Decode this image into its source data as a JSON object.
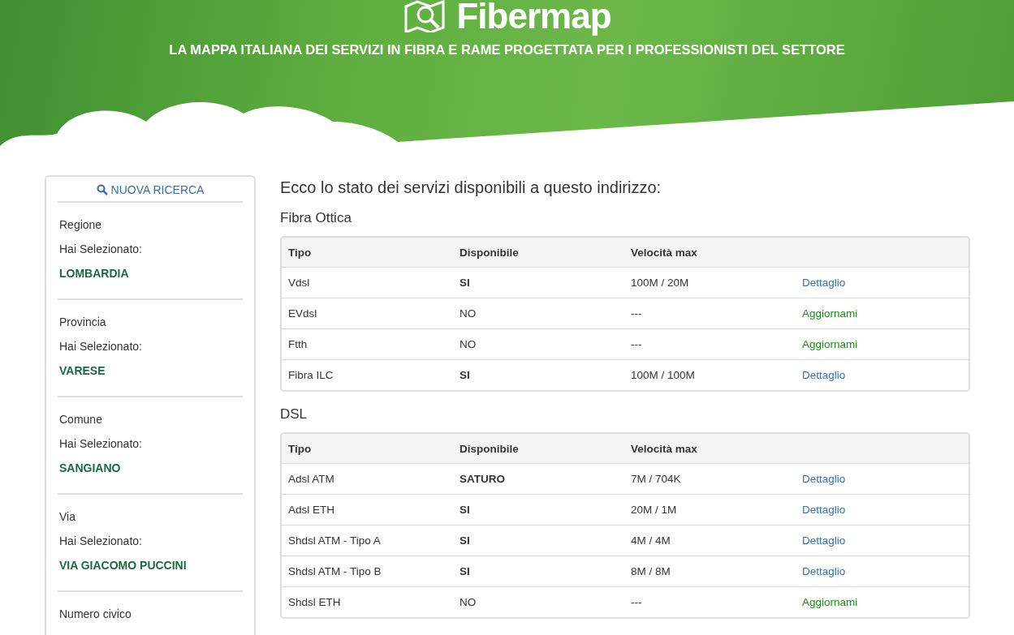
{
  "header": {
    "logo": "Fibermap",
    "tagline": "LA MAPPA ITALIANA DEI SERVIZI IN FIBRA E RAME PROGETTATA PER I PROFESSIONISTI DEL SETTORE"
  },
  "sidebar": {
    "search_link": "NUOVA RICERCA",
    "sections": [
      {
        "label": "Regione",
        "prompt": "Hai Selezionato:",
        "value": "LOMBARDIA"
      },
      {
        "label": "Provincia",
        "prompt": "Hai Selezionato:",
        "value": "VARESE"
      },
      {
        "label": "Comune",
        "prompt": "Hai Selezionato:",
        "value": "SANGIANO"
      },
      {
        "label": "Via",
        "prompt": "Hai Selezionato:",
        "value": "VIA GIACOMO PUCCINI"
      },
      {
        "label": "Numero civico"
      }
    ]
  },
  "main": {
    "heading": "Ecco lo stato dei servizi disponibili a questo indirizzo:",
    "groups": [
      {
        "title": "Fibra Ottica",
        "columns": [
          "Tipo",
          "Disponibile",
          "Velocità max"
        ],
        "rows": [
          {
            "type": "Vdsl",
            "available": "SI",
            "highlight": true,
            "speed": "100M / 20M",
            "action": {
              "kind": "details",
              "label": "Dettaglio"
            }
          },
          {
            "type": "EVdsl",
            "available": "NO",
            "highlight": false,
            "speed": "---",
            "action": {
              "kind": "upgrade",
              "label": "Aggiornami"
            }
          },
          {
            "type": "Ftth",
            "available": "NO",
            "highlight": false,
            "speed": "---",
            "action": {
              "kind": "upgrade",
              "label": "Aggiornami"
            }
          },
          {
            "type": "Fibra ILC",
            "available": "SI",
            "highlight": true,
            "speed": "100M / 100M",
            "action": {
              "kind": "details",
              "label": "Dettaglio"
            }
          }
        ]
      },
      {
        "title": "DSL",
        "columns": [
          "Tipo",
          "Disponibile",
          "Velocità max"
        ],
        "rows": [
          {
            "type": "Adsl ATM",
            "available": "SATURO",
            "highlight": true,
            "speed": "7M / 704K",
            "action": {
              "kind": "details",
              "label": "Dettaglio"
            }
          },
          {
            "type": "Adsl ETH",
            "available": "SI",
            "highlight": true,
            "speed": "20M / 1M",
            "action": {
              "kind": "details",
              "label": "Dettaglio"
            }
          },
          {
            "type": "Shdsl ATM - Tipo A",
            "available": "SI",
            "highlight": true,
            "speed": "4M / 4M",
            "action": {
              "kind": "details",
              "label": "Dettaglio"
            }
          },
          {
            "type": "Shdsl ATM - Tipo B",
            "available": "SI",
            "highlight": true,
            "speed": "8M / 8M",
            "action": {
              "kind": "details",
              "label": "Dettaglio"
            }
          },
          {
            "type": "Shdsl ETH",
            "available": "NO",
            "highlight": false,
            "speed": "---",
            "action": {
              "kind": "upgrade",
              "label": "Aggiornami"
            }
          }
        ]
      }
    ]
  }
}
